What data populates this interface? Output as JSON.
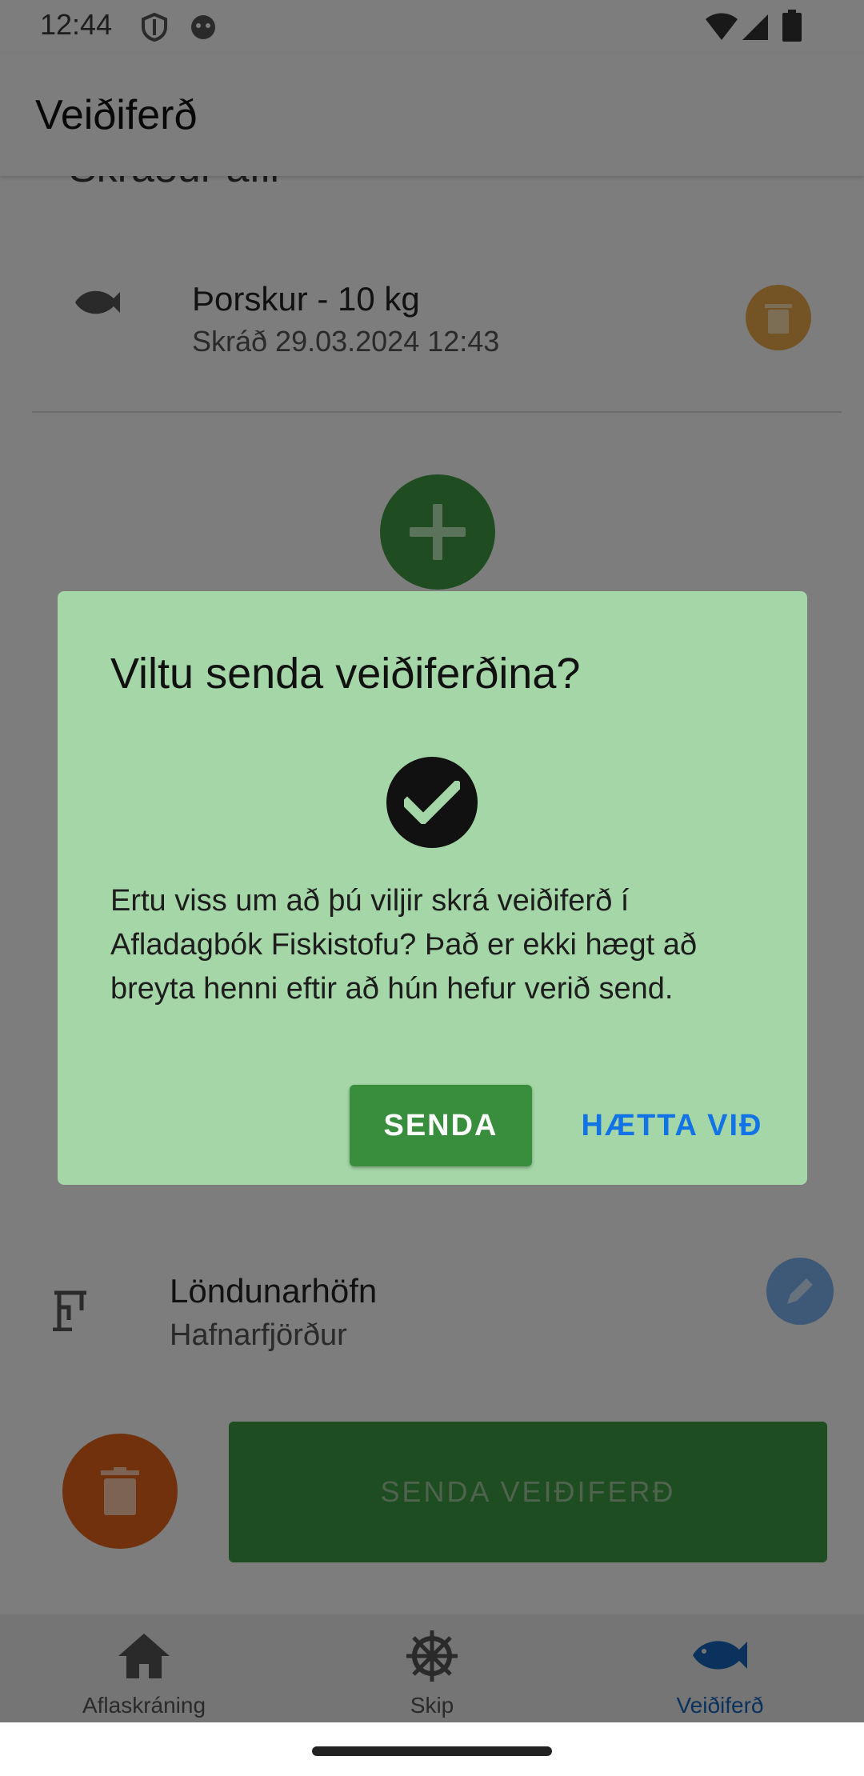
{
  "status_bar": {
    "time": "12:44"
  },
  "app_bar": {
    "title": "Veiðiferð"
  },
  "section": {
    "title_partial": "Skráður afli"
  },
  "catch_item": {
    "title": "Þorskur - 10 kg",
    "subtitle": "Skráð 29.03.2024 12:43"
  },
  "landing_port": {
    "label": "Löndunarhöfn",
    "value": "Hafnarfjörður"
  },
  "actions": {
    "send_trip": "SENDA VEIÐIFERÐ"
  },
  "dialog": {
    "title": "Viltu senda veiðiferðina?",
    "body": "Ertu viss um að þú viljir skrá veiðiferð í Afladagbók Fiskistofu? Það er ekki hægt að breyta henni eftir að hún hefur verið send.",
    "confirm_label": "SENDA",
    "cancel_label": "HÆTTA VIÐ"
  },
  "bottom_nav": {
    "items": [
      {
        "label": "Aflaskráning",
        "icon": "home-icon",
        "active": false
      },
      {
        "label": "Skip",
        "icon": "ship-wheel-icon",
        "active": false
      },
      {
        "label": "Veiðiferð",
        "icon": "fish-icon",
        "active": true
      }
    ]
  },
  "colors": {
    "dialog_bg": "#a5d6a7",
    "primary_green": "#388e3c",
    "cancel_blue": "#1273e6",
    "delete_orange": "#e2621b",
    "nav_active": "#1664b8"
  }
}
